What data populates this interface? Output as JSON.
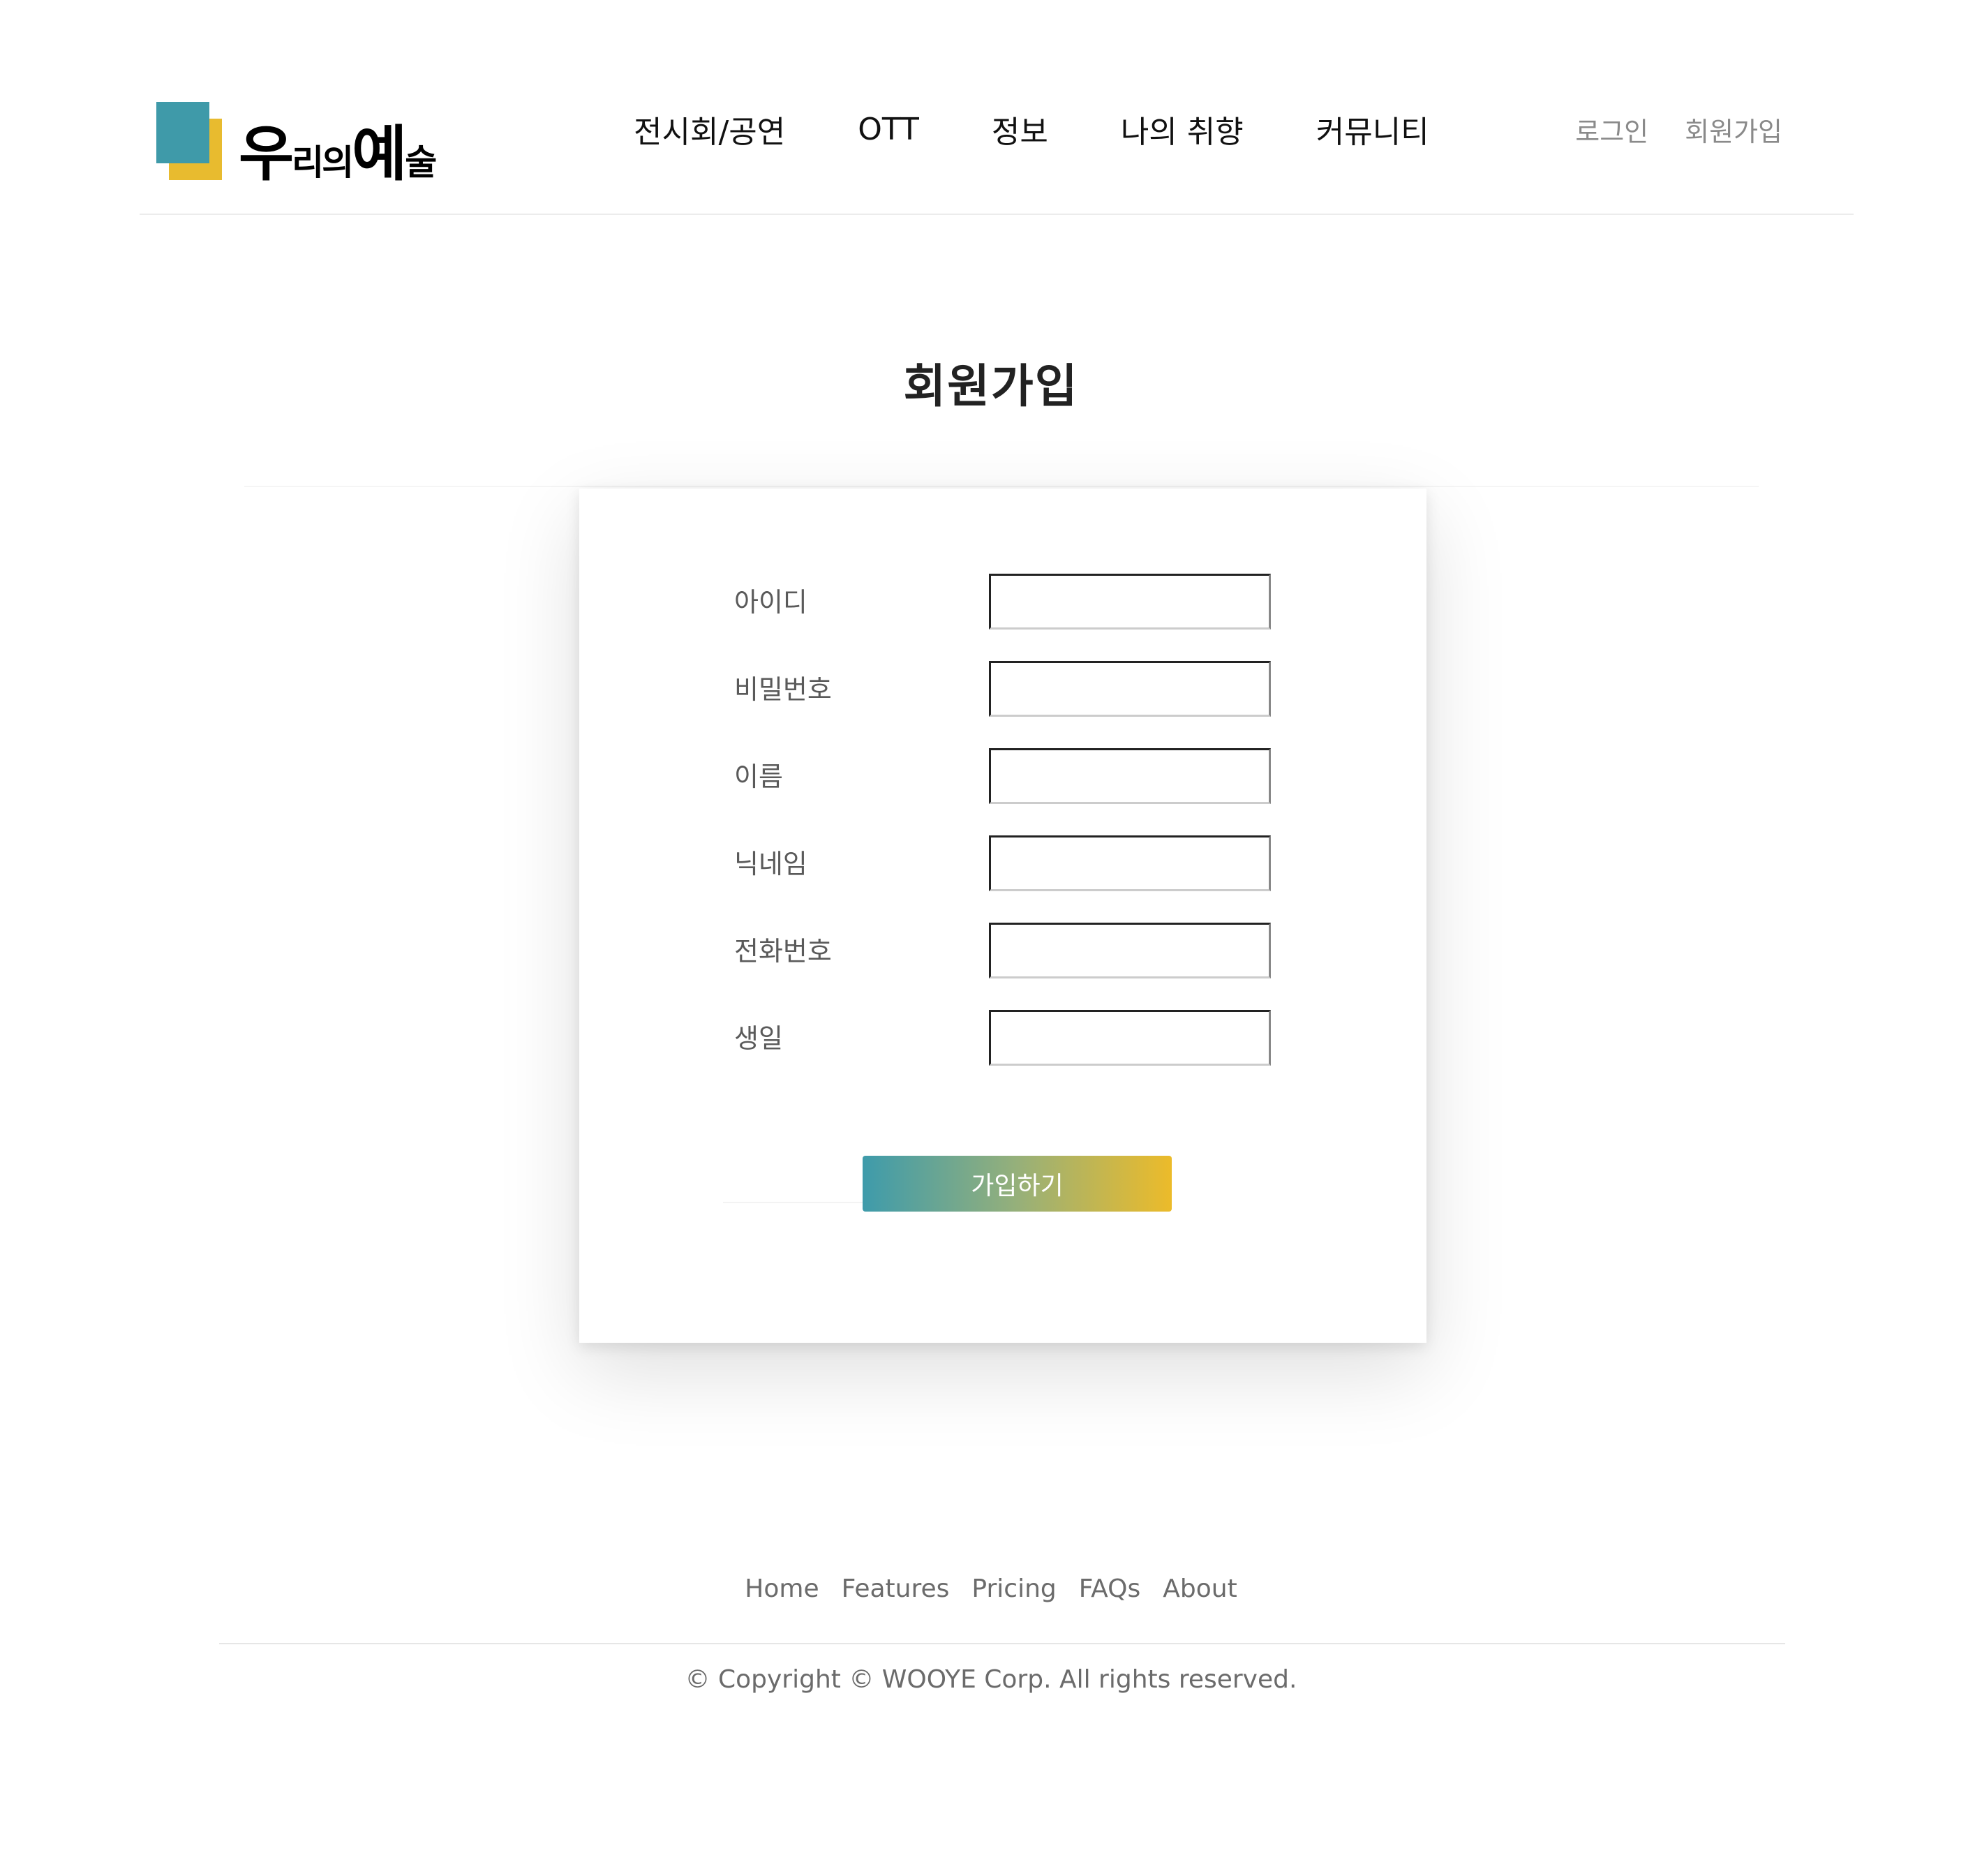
{
  "header": {
    "logo": {
      "part1": "우",
      "part2": "리의",
      "part3": "예",
      "part4": "술"
    },
    "nav": [
      {
        "label": "전시회/공연"
      },
      {
        "label": "OTT"
      },
      {
        "label": "정보"
      },
      {
        "label": "나의 취향"
      },
      {
        "label": "커뮤니티"
      }
    ],
    "auth": {
      "login": "로그인",
      "signup": "회원가입"
    }
  },
  "page": {
    "title": "회원가입"
  },
  "form": {
    "fields": [
      {
        "label": "아이디",
        "value": ""
      },
      {
        "label": "비밀번호",
        "value": ""
      },
      {
        "label": "이름",
        "value": ""
      },
      {
        "label": "닉네임",
        "value": ""
      },
      {
        "label": "전화번호",
        "value": ""
      },
      {
        "label": "생일",
        "value": ""
      }
    ],
    "submit_label": "가입하기"
  },
  "footer": {
    "links": [
      {
        "label": "Home"
      },
      {
        "label": "Features"
      },
      {
        "label": "Pricing"
      },
      {
        "label": "FAQs"
      },
      {
        "label": "About"
      }
    ],
    "copyright": "© Copyright © WOOYE Corp. All rights reserved."
  },
  "colors": {
    "logo_teal": "#3f9aa9",
    "logo_yellow": "#e8bb2f",
    "button_gradient_start": "#3e9bab",
    "button_gradient_end": "#ecbb2a"
  }
}
